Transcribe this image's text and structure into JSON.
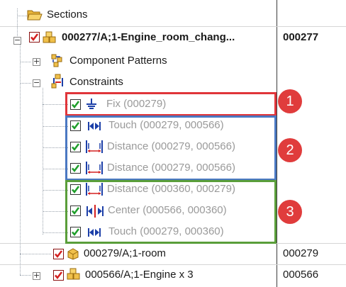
{
  "tree": {
    "sections": {
      "label": "Sections"
    },
    "root": {
      "label": "000277/A;1-Engine_room_chang...",
      "id_value": "000277"
    },
    "component_patterns": {
      "label": "Component Patterns"
    },
    "constraints": {
      "label": "Constraints"
    },
    "constraint_items": [
      {
        "label": "Fix (000279)",
        "type": "fix"
      },
      {
        "label": "Touch (000279, 000566)",
        "type": "touch"
      },
      {
        "label": "Distance (000279, 000566)",
        "type": "distance"
      },
      {
        "label": "Distance (000279, 000566)",
        "type": "distance"
      },
      {
        "label": "Distance (000360, 000279)",
        "type": "distance"
      },
      {
        "label": "Center (000566, 000360)",
        "type": "center"
      },
      {
        "label": "Touch (000279, 000360)",
        "type": "touch"
      }
    ],
    "room": {
      "label": "000279/A;1-room",
      "id_value": "000279"
    },
    "engine": {
      "label": "000566/A;1-Engine x 3",
      "id_value": "000566"
    }
  },
  "callouts": [
    {
      "number": "1",
      "color": "#e0353a"
    },
    {
      "number": "2",
      "color": "#4a78c2"
    },
    {
      "number": "3",
      "color": "#5a9e3a"
    }
  ],
  "colors": {
    "badge": "#e03c3c",
    "check_green": "#1e9e2a",
    "check_red": "#d42020",
    "constraint_icon": "#1c3fa8",
    "folder": "#f0c04a"
  }
}
